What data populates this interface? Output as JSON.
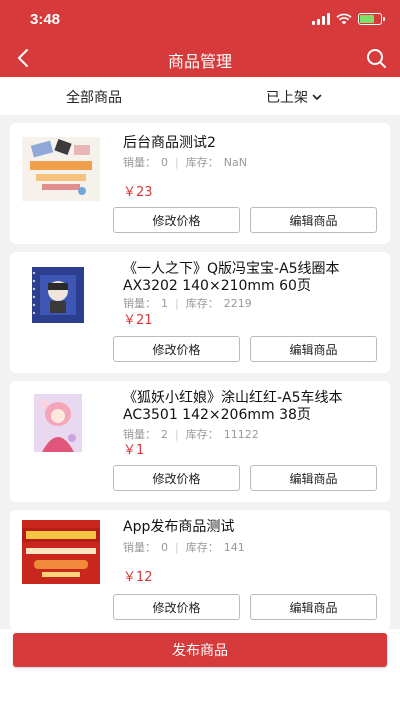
{
  "status_bar": {
    "time": "3:48",
    "battery_color": "#7ee06a"
  },
  "nav": {
    "title": "商品管理",
    "back_icon": "chevron-left-icon",
    "search_icon": "search-icon"
  },
  "filter": {
    "all_label": "全部商品",
    "status_label": "已上架"
  },
  "labels": {
    "sales": "销量：",
    "stock": "库存：",
    "edit_price": "修改价格",
    "edit_product": "编辑商品",
    "currency": "￥"
  },
  "products": [
    {
      "title": "后台商品测试2",
      "sales": "0",
      "stock": "NaN",
      "price": "23"
    },
    {
      "title": "《一人之下》Q版冯宝宝-A5线圈本AX3202 140×210mm 60页",
      "sales": "1",
      "stock": "2219",
      "price": "21"
    },
    {
      "title": "《狐妖小红娘》涂山红红-A5车线本AC3501 142×206mm 38页",
      "sales": "2",
      "stock": "11122",
      "price": "1"
    },
    {
      "title": "App发布商品测试",
      "sales": "0",
      "stock": "141",
      "price": "12"
    }
  ],
  "publish_label": "发布商品",
  "colors": {
    "brand": "#d73a3a",
    "price": "#d73a3a"
  }
}
